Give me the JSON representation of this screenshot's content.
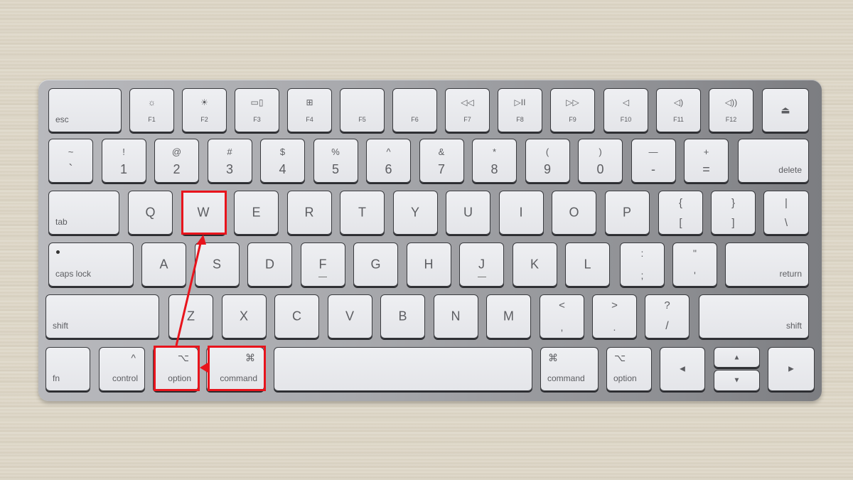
{
  "image": {
    "description": "Apple Magic Keyboard on light wood desk, with option+command+W keys highlighted",
    "highlight_color": "#e8141c",
    "background_color": "#ddd6c6",
    "highlighted_keys": [
      "option",
      "command",
      "W"
    ]
  },
  "keys": {
    "esc": "esc",
    "f1": "F1",
    "f2": "F2",
    "f3": "F3",
    "f4": "F4",
    "f5": "F5",
    "f6": "F6",
    "f7": "F7",
    "f8": "F8",
    "f9": "F9",
    "f10": "F10",
    "f11": "F11",
    "f12": "F12",
    "icons": {
      "f1": "☼",
      "f2": "☀",
      "f3": "▭▯",
      "f4": "⊞",
      "f7": "◁◁",
      "f8": "▷II",
      "f9": "▷▷",
      "f10": "◁",
      "f11": "◁)",
      "f12": "◁))",
      "eject": "⏏"
    },
    "number_row": [
      {
        "top": "~",
        "bot": "`"
      },
      {
        "top": "!",
        "bot": "1"
      },
      {
        "top": "@",
        "bot": "2"
      },
      {
        "top": "#",
        "bot": "3"
      },
      {
        "top": "$",
        "bot": "4"
      },
      {
        "top": "%",
        "bot": "5"
      },
      {
        "top": "^",
        "bot": "6"
      },
      {
        "top": "&",
        "bot": "7"
      },
      {
        "top": "*",
        "bot": "8"
      },
      {
        "top": "(",
        "bot": "9"
      },
      {
        "top": ")",
        "bot": "0"
      },
      {
        "top": "—",
        "bot": "-"
      },
      {
        "top": "+",
        "bot": "="
      }
    ],
    "delete": "delete",
    "tab": "tab",
    "qwerty": [
      "Q",
      "W",
      "E",
      "R",
      "T",
      "Y",
      "U",
      "I",
      "O",
      "P"
    ],
    "lbrace": {
      "top": "{",
      "bot": "["
    },
    "rbrace": {
      "top": "}",
      "bot": "]"
    },
    "pipe": {
      "top": "|",
      "bot": "\\"
    },
    "caps_lock": "caps lock",
    "asdf": [
      "A",
      "S",
      "D",
      "F",
      "G",
      "H",
      "J",
      "K",
      "L"
    ],
    "semicolon": {
      "top": ":",
      "bot": ";"
    },
    "quote": {
      "top": "\"",
      "bot": "'"
    },
    "return": "return",
    "shift": "shift",
    "zxcv": [
      "Z",
      "X",
      "C",
      "V",
      "B",
      "N",
      "M"
    ],
    "comma": {
      "top": "<",
      "bot": ","
    },
    "period": {
      "top": ">",
      "bot": "."
    },
    "slash": {
      "top": "?",
      "bot": "/"
    },
    "fn": "fn",
    "control": "control",
    "control_icon": "^",
    "option": "option",
    "option_icon": "⌥",
    "command": "command",
    "command_icon": "⌘",
    "arrow_left": "◀",
    "arrow_up": "▲",
    "arrow_down": "▼",
    "arrow_right": "▶"
  }
}
